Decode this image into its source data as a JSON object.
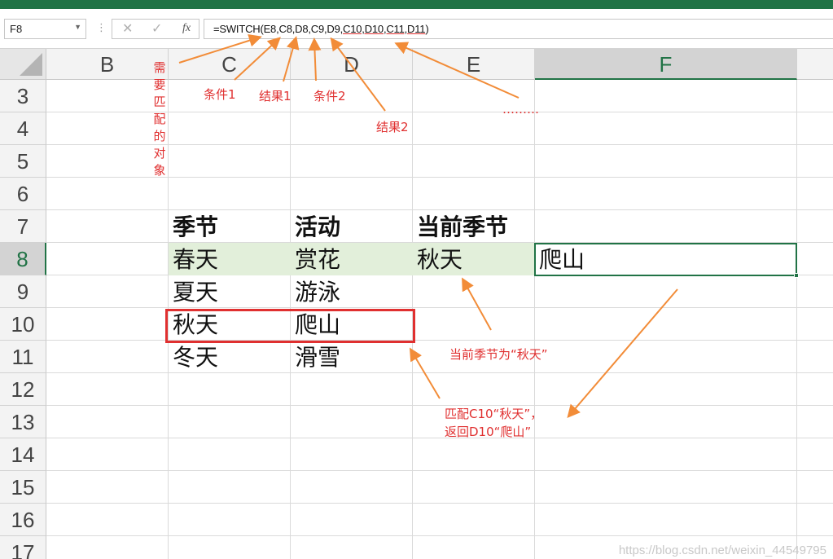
{
  "formula_bar": {
    "name_box": "F8",
    "cancel_icon": "close-icon",
    "enter_icon": "check-icon",
    "fx_label": "fx",
    "formula_parts": {
      "plain": "=SWITCH(E8,C8,D8,C9,D9,",
      "underlined": "C10,D10,C11,D11",
      "close": ")"
    }
  },
  "columns": [
    "B",
    "C",
    "D",
    "E",
    "F"
  ],
  "rows": [
    "3",
    "4",
    "5",
    "6",
    "7",
    "8",
    "9",
    "10",
    "11",
    "12",
    "13",
    "14",
    "15",
    "16",
    "17"
  ],
  "selected": {
    "column": "F",
    "row": "8"
  },
  "sheet": {
    "header": {
      "season": "季节",
      "activity": "活动",
      "current": "当前季节"
    },
    "table": [
      {
        "season": "春天",
        "activity": "赏花"
      },
      {
        "season": "夏天",
        "activity": "游泳"
      },
      {
        "season": "秋天",
        "activity": "爬山"
      },
      {
        "season": "冬天",
        "activity": "滑雪"
      }
    ],
    "current_value": "秋天",
    "result_value": "爬山"
  },
  "annotations": {
    "match_object": "需要匹配的对象",
    "cond1": "条件1",
    "res1": "结果1",
    "cond2": "条件2",
    "res2": "结果2",
    "dots": "………",
    "current_note": "当前季节为“秋天”",
    "match_line1": "匹配C10“秋天”，",
    "match_line2": "返回D10“爬山”"
  },
  "watermark": "https://blog.csdn.net/weixin_44549795",
  "colors": {
    "excel_green": "#217346",
    "annotation_red": "#e03030",
    "arrow_orange": "#f28c38",
    "header_band": "#e2efda"
  }
}
